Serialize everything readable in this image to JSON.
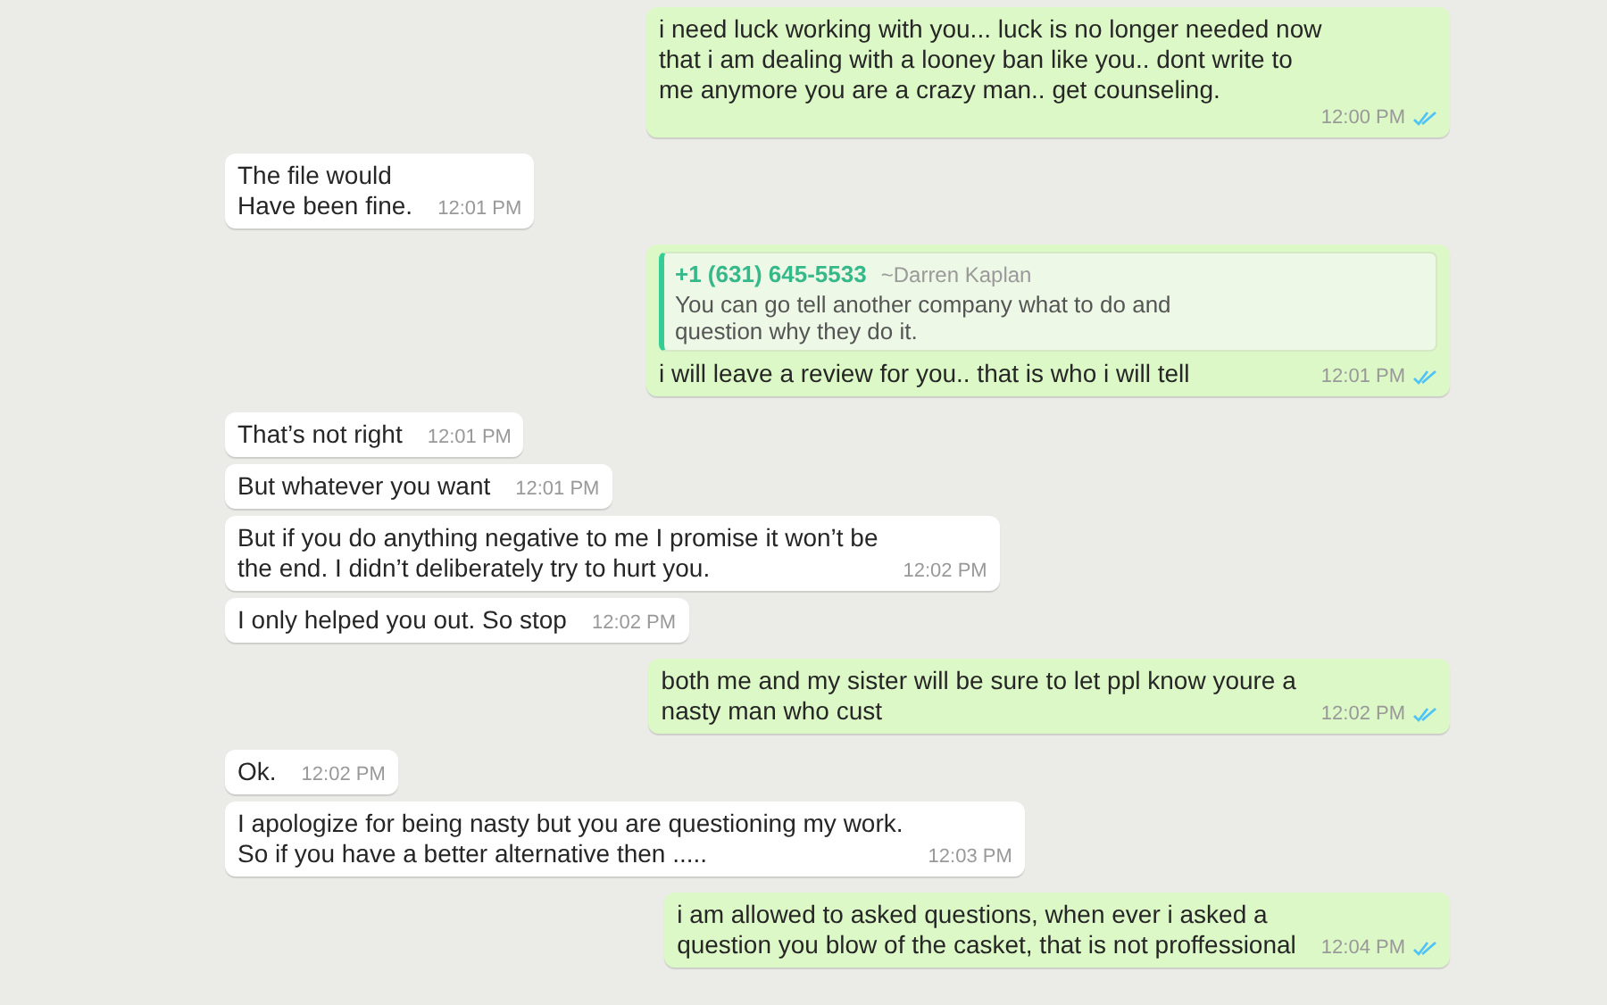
{
  "messages": [
    {
      "kind": "out",
      "text": "i need luck working with you... luck is no longer needed now\nthat i am dealing with a looney ban like you.. dont write to\nme anymore you are a crazy man.. get counseling.",
      "time": "12:00 PM",
      "read": true
    },
    {
      "kind": "in",
      "text": "The file would\nHave been fine.",
      "time": "12:01 PM"
    },
    {
      "kind": "out",
      "quote": {
        "name": "+1 (631) 645-5533",
        "sender": "~Darren Kaplan",
        "text": "You can go tell another company what to do and\nquestion why they do it."
      },
      "text": "i will leave a review for you.. that is who i will tell",
      "time": "12:01 PM",
      "read": true
    },
    {
      "kind": "in",
      "text": "That’s not right",
      "time": "12:01 PM"
    },
    {
      "kind": "in",
      "text": "But whatever you want",
      "time": "12:01 PM"
    },
    {
      "kind": "in",
      "text": "But if you do anything negative to me I promise it won’t be\nthe end. I didn’t deliberately try to hurt you.",
      "time": "12:02 PM"
    },
    {
      "kind": "in",
      "text": "I only helped you out. So stop",
      "time": "12:02 PM"
    },
    {
      "kind": "out",
      "text": "both me and my sister will be sure to let ppl know youre a\nnasty man who cust",
      "time": "12:02 PM",
      "read": true
    },
    {
      "kind": "in",
      "text": "Ok.",
      "time": "12:02 PM"
    },
    {
      "kind": "in",
      "text": "I apologize for being nasty but you are questioning my work.\nSo if you have a better alternative then .....",
      "time": "12:03 PM"
    },
    {
      "kind": "out",
      "text": "i am allowed to asked questions, when ever i asked a\nquestion you blow of the casket, that is not proffessional",
      "time": "12:04 PM",
      "read": true
    }
  ]
}
